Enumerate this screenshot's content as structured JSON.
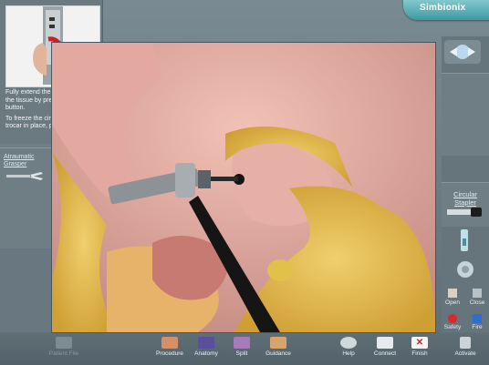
{
  "app": {
    "logo": "Simbionix"
  },
  "instruction": {
    "paragraphs": [
      "Fully extend the trocar and pierce the tissue by pressing the \"open\" button.",
      "To freeze the circular stapler and trocar in place, press the pedal."
    ]
  },
  "left_tool": {
    "label": "Atraumatic Grasper"
  },
  "right_tool": {
    "label": "Circular Stapler"
  },
  "controls": {
    "open": "Open",
    "close": "Close",
    "safety": "Safety",
    "fire": "Fire",
    "activate": "Activate"
  },
  "toolbar": {
    "patient_file": "Patient File",
    "procedure": "Procedure",
    "anatomy": "Anatomy",
    "split": "Split",
    "guidance": "Guidance",
    "help": "Help",
    "connect": "Connect",
    "finish": "Finish"
  },
  "colors": {
    "accent": "#3d9aa4",
    "safety": "#e0262a",
    "fire": "#2d6fd0",
    "tissue_fat": "#d9b24a",
    "tissue_pink": "#d98d86"
  }
}
